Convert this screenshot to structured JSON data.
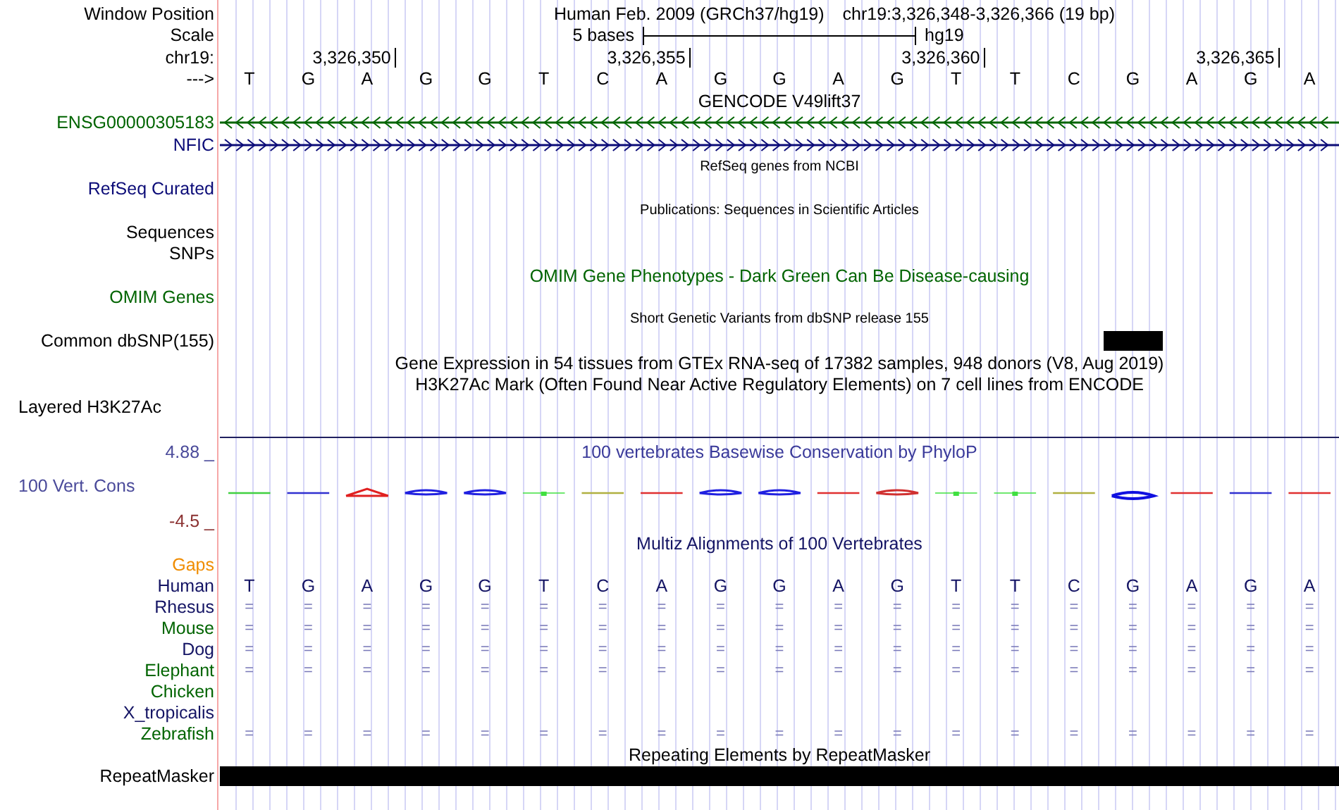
{
  "header": {
    "label": "Window Position",
    "assembly": "Human Feb. 2009 (GRCh37/hg19)",
    "position": "chr19:3,326,348-3,326,366 (19 bp)"
  },
  "scale": {
    "label": "Scale",
    "span": "5 bases",
    "db": "hg19"
  },
  "ruler": {
    "label": "chr19:",
    "ticks": [
      "3,326,350",
      "3,326,355",
      "3,326,360",
      "3,326,365"
    ]
  },
  "sequence": {
    "label": "--->",
    "bases": [
      "T",
      "G",
      "A",
      "G",
      "G",
      "T",
      "C",
      "A",
      "G",
      "G",
      "A",
      "G",
      "T",
      "T",
      "C",
      "G",
      "A",
      "G",
      "A"
    ]
  },
  "tracks": [
    {
      "kind": "title",
      "text": "GENCODE V49lift37"
    },
    {
      "kind": "gene",
      "label": "ENSG00000305183",
      "color": "#006400",
      "reverse": true
    },
    {
      "kind": "gene",
      "label": "NFIC",
      "color": "#0c0c78",
      "reverse": false
    },
    {
      "kind": "note",
      "text": "RefSeq genes from NCBI"
    },
    {
      "kind": "label",
      "label": "RefSeq Curated",
      "color": "#0c0c78"
    },
    {
      "kind": "note",
      "text": "Publications: Sequences in Scientific Articles"
    },
    {
      "kind": "label",
      "label": "Sequences",
      "color": "#000000"
    },
    {
      "kind": "label",
      "label": "SNPs",
      "color": "#000000"
    },
    {
      "kind": "title",
      "text": "OMIM Gene Phenotypes - Dark Green Can Be Disease-causing",
      "color": "#006400"
    },
    {
      "kind": "label",
      "label": "OMIM Genes",
      "color": "#006400"
    },
    {
      "kind": "note",
      "text": "Short Genetic Variants from dbSNP release 155"
    },
    {
      "kind": "snp",
      "label": "Common dbSNP(155)"
    },
    {
      "kind": "title",
      "text": "Gene Expression in 54 tissues from GTEx RNA-seq of 17382 samples, 948 donors (V8, Aug 2019)"
    },
    {
      "kind": "title",
      "text": "H3K27Ac Mark (Often Found Near Active Regulatory Elements) on 7 cell lines from ENCODE"
    },
    {
      "kind": "indented_label",
      "label": "Layered H3K27Ac"
    },
    {
      "kind": "conservation",
      "title": "100 vertebrates Basewise Conservation by PhyloP",
      "label": "100 Vert. Cons",
      "max": "4.88 _",
      "min": "-4.5 _"
    },
    {
      "kind": "title",
      "text": "Multiz Alignments of 100 Vertebrates",
      "color": "#141464"
    },
    {
      "kind": "label",
      "label": "Gaps",
      "color": "#f08c00"
    },
    {
      "kind": "species",
      "label": "Human",
      "color": "#141464",
      "cells": [
        "T",
        "G",
        "A",
        "G",
        "G",
        "T",
        "C",
        "A",
        "G",
        "G",
        "A",
        "G",
        "T",
        "T",
        "C",
        "G",
        "A",
        "G",
        "A"
      ]
    },
    {
      "kind": "species",
      "label": "Rhesus",
      "color": "#141464",
      "cells": [
        "=",
        "=",
        "=",
        "=",
        "=",
        "=",
        "=",
        "=",
        "=",
        "=",
        "=",
        "=",
        "=",
        "=",
        "=",
        "=",
        "=",
        "=",
        "="
      ]
    },
    {
      "kind": "species",
      "label": "Mouse",
      "color": "#006400",
      "cells": [
        "=",
        "=",
        "=",
        "=",
        "=",
        "=",
        "=",
        "=",
        "=",
        "=",
        "=",
        "=",
        "=",
        "=",
        "=",
        "=",
        "=",
        "=",
        "="
      ]
    },
    {
      "kind": "species",
      "label": "Dog",
      "color": "#141464",
      "cells": [
        "=",
        "=",
        "=",
        "=",
        "=",
        "=",
        "=",
        "=",
        "=",
        "=",
        "=",
        "=",
        "=",
        "=",
        "=",
        "=",
        "=",
        "=",
        "="
      ]
    },
    {
      "kind": "species",
      "label": "Elephant",
      "color": "#006400",
      "cells": [
        "=",
        "=",
        "=",
        "=",
        "=",
        "=",
        "=",
        "=",
        "=",
        "=",
        "=",
        "=",
        "=",
        "=",
        "=",
        "=",
        "=",
        "=",
        "="
      ]
    },
    {
      "kind": "species",
      "label": "Chicken",
      "color": "#006400"
    },
    {
      "kind": "species",
      "label": "X_tropicalis",
      "color": "#141464"
    },
    {
      "kind": "species",
      "label": "Zebrafish",
      "color": "#006400",
      "cells": [
        "=",
        "=",
        "=",
        "=",
        "=",
        "=",
        "=",
        "=",
        "=",
        "=",
        "=",
        "=",
        "=",
        "=",
        "=",
        "=",
        "=",
        "=",
        "="
      ]
    },
    {
      "kind": "title",
      "text": "Repeating Elements by RepeatMasker"
    },
    {
      "kind": "repeat",
      "label": "RepeatMasker"
    }
  ]
}
